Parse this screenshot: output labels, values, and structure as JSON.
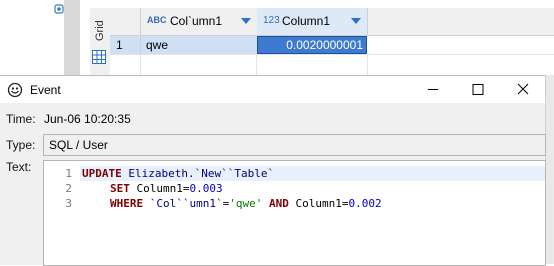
{
  "background_grid": {
    "side_tab_label": "Grid",
    "columns": [
      {
        "type_badge": "ABC",
        "name": "Col`umn1"
      },
      {
        "type_badge": "123",
        "name": "Column1"
      }
    ],
    "rows": [
      {
        "row_number": "1",
        "col1": "qwe",
        "col2": "0.0020000001"
      }
    ]
  },
  "dialog": {
    "title": "Event",
    "labels": {
      "time": "Time:",
      "type": "Type:",
      "text": "Text:"
    },
    "time_value": "Jun-06 10:20:35",
    "type_value": "SQL / User",
    "code": {
      "line_numbers": [
        "1",
        "2",
        "3"
      ],
      "line1": {
        "kw_update": "UPDATE",
        "table": "Elizabeth.`New``Table`"
      },
      "line2": {
        "kw_set": "SET",
        "column": "Column1",
        "eq": "=",
        "value": "0.003"
      },
      "line3": {
        "kw_where": "WHERE",
        "column1": "`Col``umn1`",
        "eq1": "=",
        "str_value": "'qwe'",
        "kw_and": "AND",
        "column2": "Column1",
        "eq2": "=",
        "value2": "0.002"
      }
    }
  },
  "colors": {
    "selection_blue": "#3f7ad1",
    "row_highlight": "#cfe0f4",
    "keyword": "#800000",
    "string": "#007a00",
    "number": "#0000c8"
  }
}
